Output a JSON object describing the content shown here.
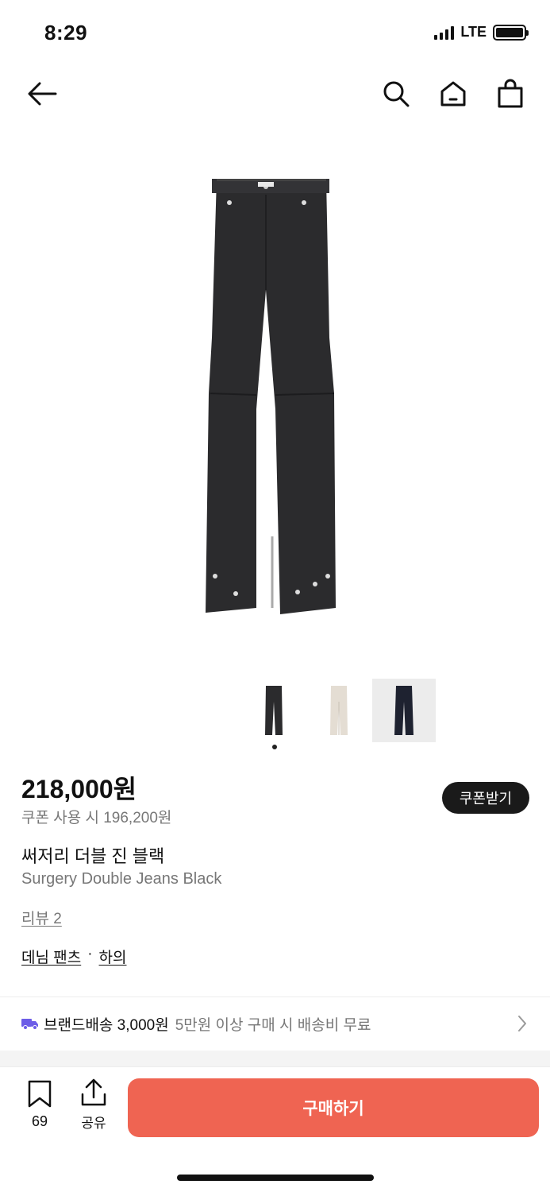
{
  "status_bar": {
    "time": "8:29",
    "network": "LTE"
  },
  "nav": {
    "icons": [
      "back-arrow-icon",
      "search-icon",
      "home-icon",
      "shopping-bag-icon"
    ]
  },
  "product": {
    "price": "218,000원",
    "coupon_price": "쿠폰 사용 시 196,200원",
    "coupon_button": "쿠폰받기",
    "name_ko": "써저리 더블 진 블랙",
    "name_en": "Surgery Double Jeans Black",
    "review": "리뷰 2",
    "category": {
      "primary": "데님 팬츠",
      "separator": "·",
      "secondary": "하의"
    },
    "thumbnails": [
      {
        "color": "black",
        "selected": true
      },
      {
        "color": "ecru",
        "selected": false
      },
      {
        "color": "black-on-gray",
        "selected": false
      }
    ]
  },
  "shipping": {
    "label": "브랜드배송 3,000원",
    "note": "5만원 이상 구매 시 배송비 무료"
  },
  "bottom_bar": {
    "bookmark_count": "69",
    "share_label": "공유",
    "buy_label": "구매하기"
  },
  "colors": {
    "accent": "#ef6452",
    "dark_button": "#1a1a1a",
    "shipping_icon": "#6c5ce7",
    "muted_text": "#777777"
  }
}
